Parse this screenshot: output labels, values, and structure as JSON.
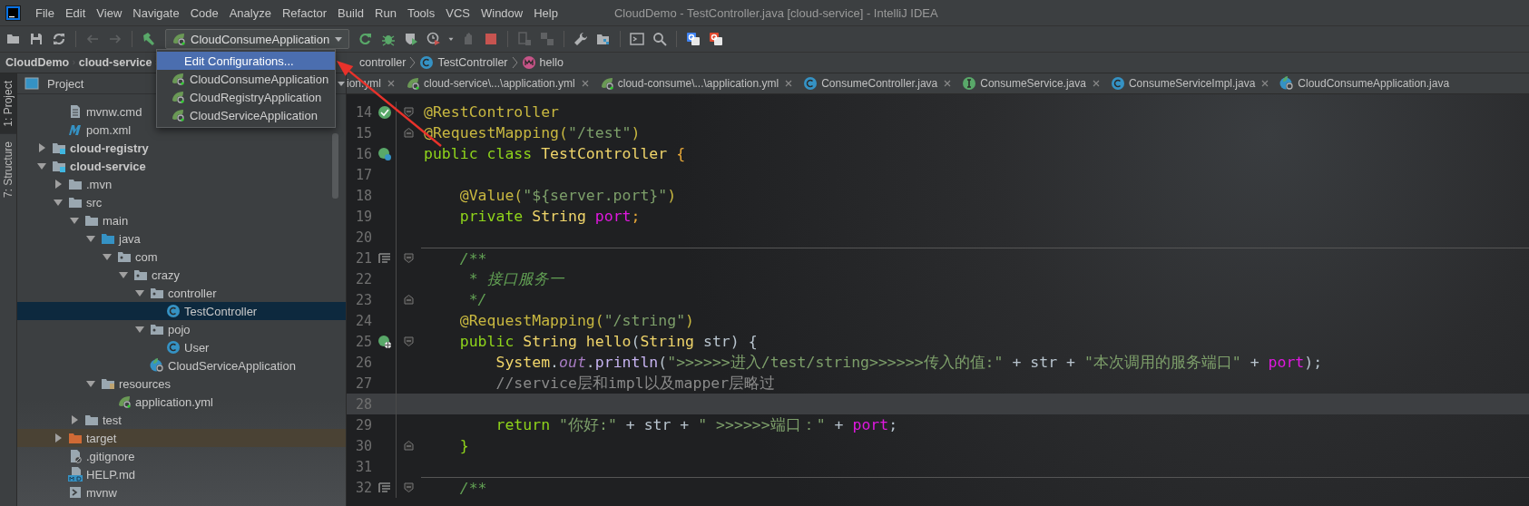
{
  "menu": {
    "items": [
      "File",
      "Edit",
      "View",
      "Navigate",
      "Code",
      "Analyze",
      "Refactor",
      "Build",
      "Run",
      "Tools",
      "VCS",
      "Window",
      "Help"
    ],
    "title": "CloudDemo - TestController.java [cloud-service] - IntelliJ IDEA"
  },
  "toolbar": {
    "groups": [
      [
        {
          "kind": "open",
          "disabled": false
        },
        {
          "kind": "save",
          "disabled": false
        },
        {
          "kind": "sync",
          "disabled": false
        }
      ],
      [
        {
          "kind": "back",
          "disabled": true
        },
        {
          "kind": "forward",
          "disabled": true
        }
      ],
      [
        {
          "kind": "build",
          "disabled": false
        },
        {
          "kind": "run-config",
          "disabled": false
        },
        {
          "kind": "rerun",
          "disabled": false
        },
        {
          "kind": "debug",
          "disabled": false
        },
        {
          "kind": "coverage",
          "disabled": false
        },
        {
          "kind": "profile",
          "disabled": false
        },
        {
          "kind": "caret",
          "disabled": false
        },
        {
          "kind": "attach",
          "disabled": true
        },
        {
          "kind": "stop",
          "disabled": false
        }
      ],
      [
        {
          "kind": "device",
          "disabled": true
        },
        {
          "kind": "deploy",
          "disabled": true
        }
      ],
      [
        {
          "kind": "wrench",
          "disabled": false
        },
        {
          "kind": "structure",
          "disabled": false
        }
      ],
      [
        {
          "kind": "terminal",
          "disabled": false
        },
        {
          "kind": "search",
          "disabled": false
        }
      ],
      [
        {
          "kind": "translate-blue",
          "disabled": false
        },
        {
          "kind": "translate-red",
          "disabled": false
        }
      ]
    ],
    "run_config": {
      "value": "CloudConsumeApplication"
    }
  },
  "run_dropdown": {
    "items": [
      {
        "label": "Edit Configurations...",
        "kind": "action",
        "selected": true
      },
      {
        "label": "CloudConsumeApplication",
        "kind": "spring-boot",
        "selected": false
      },
      {
        "label": "CloudRegistryApplication",
        "kind": "spring-boot",
        "selected": false
      },
      {
        "label": "CloudServiceApplication",
        "kind": "spring-boot",
        "selected": false
      }
    ]
  },
  "breadcrumbs": {
    "before_popup": [
      {
        "label": "CloudDemo"
      },
      {
        "label": "cloud-service"
      }
    ],
    "after_popup": [
      {
        "label": "controller"
      },
      {
        "label": "TestController",
        "kind": "class"
      },
      {
        "label": "hello",
        "kind": "method"
      }
    ]
  },
  "tool_strip": [
    {
      "label": "1: Project",
      "selected": true
    },
    {
      "label": "7: Structure",
      "selected": false
    }
  ],
  "project_panel": {
    "title": "Project",
    "top_rows": [
      {
        "label": "mvnw.cmd",
        "kind": "file",
        "selected": false
      },
      {
        "label": "pom.xml",
        "kind": "maven",
        "selected": false
      }
    ],
    "tree": [
      {
        "label": "cloud-registry",
        "kind": "module",
        "expanded": false,
        "selected": false
      },
      {
        "label": "cloud-service",
        "kind": "module",
        "expanded": true,
        "selected": false,
        "children": [
          {
            "label": ".mvn",
            "kind": "folder",
            "expanded": false,
            "selected": false
          },
          {
            "label": "src",
            "kind": "folder",
            "expanded": true,
            "selected": false,
            "children": [
              {
                "label": "main",
                "kind": "folder",
                "expanded": true,
                "selected": false,
                "children": [
                  {
                    "label": "java",
                    "kind": "source-folder",
                    "expanded": true,
                    "selected": false,
                    "children": [
                      {
                        "label": "com",
                        "kind": "package",
                        "expanded": true,
                        "selected": false,
                        "children": [
                          {
                            "label": "crazy",
                            "kind": "package",
                            "expanded": true,
                            "selected": false,
                            "children": [
                              {
                                "label": "controller",
                                "kind": "package",
                                "expanded": true,
                                "selected": false,
                                "children": [
                                  {
                                    "label": "TestController",
                                    "kind": "class",
                                    "selected": true
                                  }
                                ]
                              },
                              {
                                "label": "pojo",
                                "kind": "package",
                                "expanded": true,
                                "selected": false,
                                "children": [
                                  {
                                    "label": "User",
                                    "kind": "class",
                                    "selected": false
                                  }
                                ]
                              },
                              {
                                "label": "CloudServiceApplication",
                                "kind": "spring-class",
                                "selected": false
                              }
                            ]
                          }
                        ]
                      }
                    ]
                  },
                  {
                    "label": "resources",
                    "kind": "resources",
                    "expanded": true,
                    "selected": false,
                    "children": [
                      {
                        "label": "application.yml",
                        "kind": "spring-yml",
                        "selected": false
                      }
                    ]
                  }
                ]
              },
              {
                "label": "test",
                "kind": "folder",
                "expanded": false,
                "selected": false
              }
            ]
          },
          {
            "label": "target",
            "kind": "excluded-folder",
            "expanded": false,
            "selected": false
          },
          {
            "label": ".gitignore",
            "kind": "ignore-file",
            "selected": false
          },
          {
            "label": "HELP.md",
            "kind": "markdown",
            "selected": false
          },
          {
            "label": "mvnw",
            "kind": "shell",
            "selected": false
          }
        ]
      }
    ]
  },
  "editor_tabs": [
    {
      "label": "ion.yml"
    },
    {
      "label": "cloud-service\\...\\application.yml",
      "kind": "spring-yml"
    },
    {
      "label": "cloud-consume\\...\\application.yml",
      "kind": "spring-yml"
    },
    {
      "label": "ConsumeController.java",
      "kind": "class"
    },
    {
      "label": "ConsumeService.java",
      "kind": "interface"
    },
    {
      "label": "ConsumeServiceImpl.java",
      "kind": "class"
    },
    {
      "label": "CloudConsumeApplication.java",
      "kind": "spring-class"
    }
  ],
  "editor": {
    "lines": [
      {
        "number": "14",
        "gutter_icon": {
          "kind": "bean"
        },
        "fold_marker": {
          "kind": "start"
        },
        "current": false,
        "separator": false,
        "tokens": [
          {
            "text": "@RestController",
            "kind": "annotation"
          }
        ]
      },
      {
        "number": "15",
        "fold_marker": {
          "kind": "end"
        },
        "current": false,
        "separator": false,
        "tokens": [
          {
            "text": "@RequestMapping",
            "kind": "annotation"
          },
          {
            "text": "(",
            "kind": "annotation"
          },
          {
            "text": "\"/test\"",
            "kind": "string"
          },
          {
            "text": ")",
            "kind": "annotation"
          }
        ]
      },
      {
        "number": "16",
        "gutter_icon": {
          "kind": "spring-class"
        },
        "current": false,
        "separator": false,
        "tokens": [
          {
            "text": "public class ",
            "kind": "keyword"
          },
          {
            "text": "TestController ",
            "kind": "type"
          },
          {
            "text": "{",
            "kind": "brace"
          }
        ]
      },
      {
        "number": "17",
        "current": false,
        "separator": false
      },
      {
        "number": "18",
        "current": false,
        "separator": false,
        "tokens": [
          {
            "text": "    @Value",
            "kind": "annotation"
          },
          {
            "text": "(",
            "kind": "annotation"
          },
          {
            "text": "\"${server.port}\"",
            "kind": "string"
          },
          {
            "text": ")",
            "kind": "annotation"
          }
        ]
      },
      {
        "number": "19",
        "current": false,
        "separator": false,
        "tokens": [
          {
            "text": "    private ",
            "kind": "keyword"
          },
          {
            "text": "String ",
            "kind": "type"
          },
          {
            "text": "port",
            "kind": "field"
          },
          {
            "text": ";",
            "kind": "brace"
          }
        ]
      },
      {
        "number": "20",
        "current": false,
        "separator": false
      },
      {
        "number": "21",
        "gutter_icon": {
          "kind": "doc"
        },
        "fold_marker": {
          "kind": "start"
        },
        "current": false,
        "separator": true,
        "tokens": [
          {
            "text": "    /**",
            "kind": "doc"
          }
        ]
      },
      {
        "number": "22",
        "current": false,
        "separator": false,
        "tokens": [
          {
            "text": "     * 接口服务一",
            "kind": "doc"
          }
        ]
      },
      {
        "number": "23",
        "fold_marker": {
          "kind": "end"
        },
        "current": false,
        "separator": false,
        "tokens": [
          {
            "text": "     */",
            "kind": "doc"
          }
        ]
      },
      {
        "number": "24",
        "current": false,
        "separator": false,
        "tokens": [
          {
            "text": "    @RequestMapping",
            "kind": "annotation"
          },
          {
            "text": "(",
            "kind": "annotation"
          },
          {
            "text": "\"/string\"",
            "kind": "string"
          },
          {
            "text": ")",
            "kind": "annotation"
          }
        ]
      },
      {
        "number": "25",
        "gutter_icon": {
          "kind": "web"
        },
        "fold_marker": {
          "kind": "start"
        },
        "current": false,
        "separator": false,
        "tokens": [
          {
            "text": "    public ",
            "kind": "keyword"
          },
          {
            "text": "String ",
            "kind": "type"
          },
          {
            "text": "hello",
            "kind": "type"
          },
          {
            "text": "(",
            "kind": "plain"
          },
          {
            "text": "String ",
            "kind": "type"
          },
          {
            "text": "str) {",
            "kind": "plain"
          }
        ]
      },
      {
        "number": "26",
        "current": false,
        "separator": false,
        "tokens": [
          {
            "text": "        System",
            "kind": "type"
          },
          {
            "text": ".",
            "kind": "plain"
          },
          {
            "text": "out",
            "kind": "static"
          },
          {
            "text": ".",
            "kind": "plain"
          },
          {
            "text": "println",
            "kind": "call"
          },
          {
            "text": "(",
            "kind": "plain"
          },
          {
            "text": "\">>>>>>进入/test/string>>>>>>传入的值:\"",
            "kind": "string"
          },
          {
            "text": " + str + ",
            "kind": "plain"
          },
          {
            "text": "\"本次调用的服务端口\"",
            "kind": "string"
          },
          {
            "text": " + ",
            "kind": "plain"
          },
          {
            "text": "port",
            "kind": "field"
          },
          {
            "text": ");",
            "kind": "plain"
          }
        ]
      },
      {
        "number": "27",
        "current": false,
        "separator": false,
        "tokens": [
          {
            "text": "        //service层和impl以及mapper层略过",
            "kind": "comment"
          }
        ]
      },
      {
        "number": "28",
        "current": true,
        "separator": false
      },
      {
        "number": "29",
        "current": false,
        "separator": false,
        "tokens": [
          {
            "text": "        return ",
            "kind": "keyword"
          },
          {
            "text": "\"你好:\"",
            "kind": "string"
          },
          {
            "text": " + str + ",
            "kind": "plain"
          },
          {
            "text": "\" >>>>>>端口：\"",
            "kind": "string"
          },
          {
            "text": " + ",
            "kind": "plain"
          },
          {
            "text": "port",
            "kind": "field"
          },
          {
            "text": ";",
            "kind": "plain"
          }
        ]
      },
      {
        "number": "30",
        "fold_marker": {
          "kind": "end"
        },
        "current": false,
        "separator": false,
        "tokens": [
          {
            "text": "    }",
            "kind": "keyword"
          }
        ]
      },
      {
        "number": "31",
        "current": false,
        "separator": false
      },
      {
        "number": "32",
        "gutter_icon": {
          "kind": "doc"
        },
        "fold_marker": {
          "kind": "start"
        },
        "current": false,
        "separator": true,
        "tokens": [
          {
            "text": "    /**",
            "kind": "doc"
          }
        ]
      }
    ]
  }
}
